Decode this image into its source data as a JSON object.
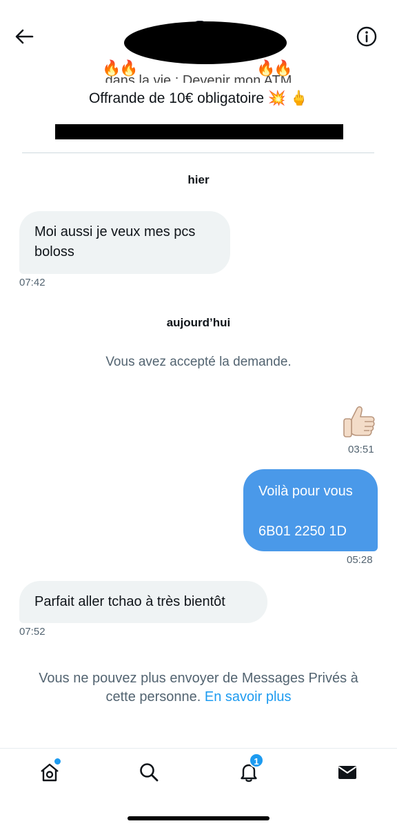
{
  "header": {
    "bio_line1_visible": "dans la vie : Devenir mon ATM",
    "bio_line2": "Offrande de 10€ obligatoire 💥 🖕",
    "fire_emojis": "🔥🔥"
  },
  "conversation": {
    "dates": {
      "yesterday": "hier",
      "today": "aujourd’hui"
    },
    "messages": [
      {
        "side": "in",
        "lines": [
          "Moi aussi je veux mes pcs",
          "boloss"
        ],
        "time": "07:42"
      },
      {
        "side": "out",
        "emoji": "👍🏻",
        "time": "03:51"
      },
      {
        "side": "out",
        "lines": [
          "Voilà pour vous",
          "",
          "6B01 2250 1D"
        ],
        "time": "05:28"
      },
      {
        "side": "in",
        "lines": [
          "Parfait aller tchao à très bientôt"
        ],
        "time": "07:52"
      }
    ],
    "system_accepted": "Vous avez accepté la demande."
  },
  "footer": {
    "note_line1": "Vous ne pouvez plus envoyer de Messages Privés à",
    "note_line2_prefix": "cette personne.",
    "note_link": "En savoir plus"
  },
  "nav": {
    "items": [
      "home-icon",
      "search-icon",
      "notifications-icon",
      "messages-icon"
    ],
    "notifications_badge": "1"
  },
  "colors": {
    "accent": "#1d9bf0",
    "outgoing_bubble": "#4a99e9",
    "incoming_bubble": "#eff3f4",
    "muted_text": "#536471"
  }
}
